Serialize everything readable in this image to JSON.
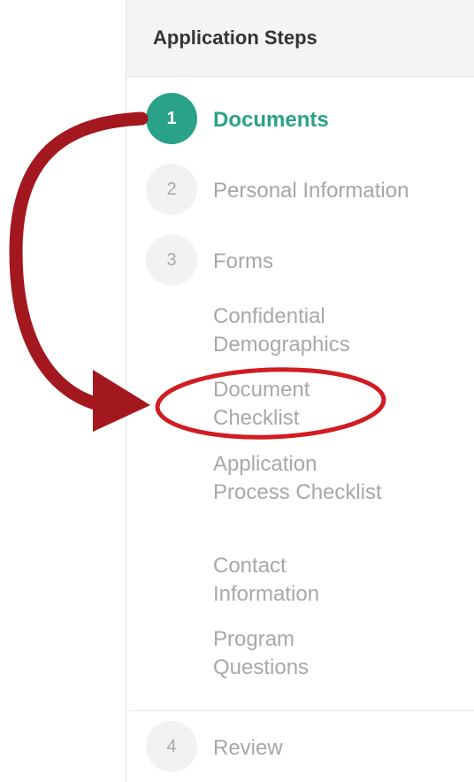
{
  "panel": {
    "title": "Application Steps",
    "steps": [
      {
        "number": "1",
        "label": "Documents",
        "state": "active"
      },
      {
        "number": "2",
        "label": "Personal Information",
        "state": "inactive"
      },
      {
        "number": "3",
        "label": "Forms",
        "state": "inactive"
      },
      {
        "number": "4",
        "label": "Review",
        "state": "inactive"
      }
    ],
    "substeps": [
      "Confidential Demographics",
      "Document Checklist",
      "Application Process Checklist",
      "Contact Information",
      "Program Questions"
    ]
  },
  "colors": {
    "accent": "#2aa189",
    "muted_text": "#a6a6a6",
    "annotation": "#a3171f"
  },
  "annotations": {
    "arrow": "curved-arrow from step 1 to Document Checklist",
    "highlight": "red ellipse around Document Checklist"
  }
}
